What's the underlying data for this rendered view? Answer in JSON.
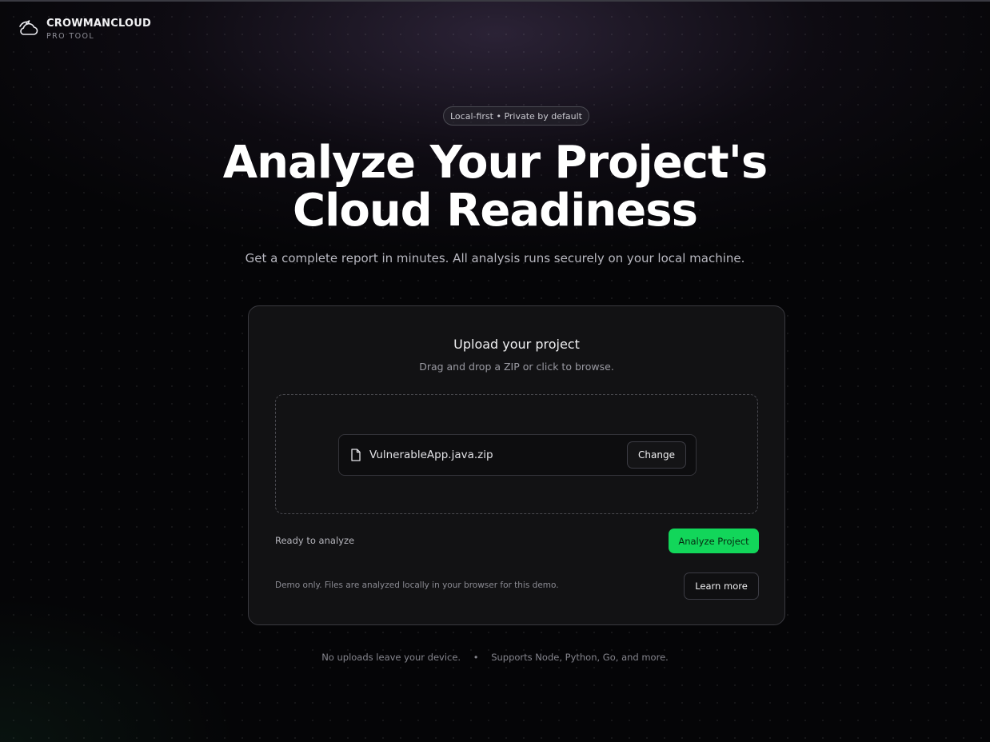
{
  "brand": {
    "name": "CROWMANCLOUD",
    "subtitle": "PRO TOOL",
    "logo_icon": "cloud-crow-icon"
  },
  "hero": {
    "badge": "Local-first • Private by default",
    "title_line1": "Analyze Your Project's",
    "title_line2": "Cloud Readiness",
    "subtitle": "Get a complete report in minutes. All analysis runs securely on your local machine."
  },
  "upload": {
    "title": "Upload your project",
    "subtitle": "Drag and drop a ZIP or click to browse.",
    "file_icon": "file-icon",
    "file_name": "VulnerableApp.java.zip",
    "change_label": "Change",
    "status": "Ready to analyze",
    "analyze_label": "Analyze Project",
    "demo_note": "Demo only. Files are analyzed locally in your browser for this demo.",
    "learn_more_label": "Learn more"
  },
  "footer": {
    "item1": "No uploads leave your device.",
    "separator": "•",
    "item2": "Supports Node, Python, Go, and more."
  },
  "colors": {
    "background": "#050507",
    "card": "#121214",
    "accent": "#12d65a"
  }
}
